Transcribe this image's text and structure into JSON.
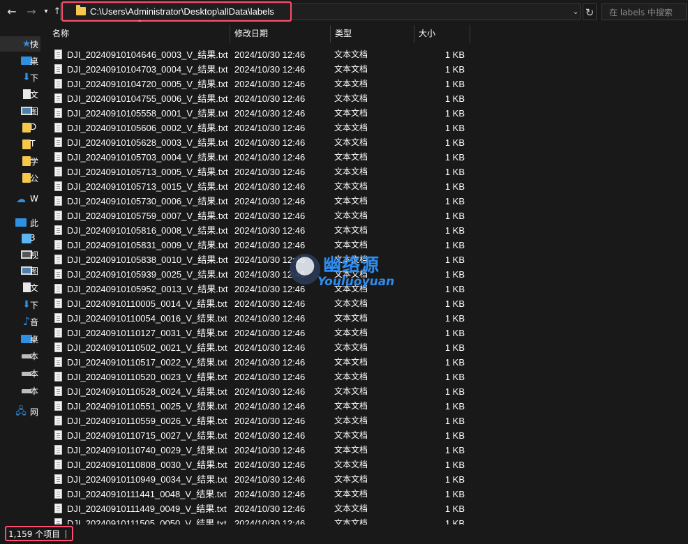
{
  "toolbar": {
    "back_icon": "arrow-left-icon",
    "forward_icon": "arrow-right-icon",
    "recent_icon": "chevron-down-icon",
    "up_icon": "arrow-up-icon",
    "address_path": "C:\\Users\\Administrator\\Desktop\\allData\\labels",
    "address_dropdown_icon": "chevron-down-icon",
    "refresh_icon": "refresh-icon",
    "search_placeholder": "在 labels 中搜索"
  },
  "sidebar": {
    "items": [
      {
        "icon": "star-icon",
        "label": "快",
        "selected": true
      },
      {
        "icon": "desktop-icon",
        "label": "桌"
      },
      {
        "icon": "download-icon",
        "label": "下"
      },
      {
        "icon": "document-icon",
        "label": "文"
      },
      {
        "icon": "picture-icon",
        "label": "图"
      },
      {
        "icon": "folder-icon",
        "label": "D"
      },
      {
        "icon": "folder-icon",
        "label": "T"
      },
      {
        "icon": "folder-icon",
        "label": "学"
      },
      {
        "icon": "folder-icon",
        "label": "公"
      },
      {
        "icon": "onedrive-icon",
        "label": "W"
      },
      {
        "icon": "computer-icon",
        "label": "此"
      },
      {
        "icon": "3d-objects-icon",
        "label": "3"
      },
      {
        "icon": "video-icon",
        "label": "视"
      },
      {
        "icon": "picture-icon",
        "label": "图"
      },
      {
        "icon": "document-icon",
        "label": "文"
      },
      {
        "icon": "download-icon",
        "label": "下"
      },
      {
        "icon": "music-icon",
        "label": "音"
      },
      {
        "icon": "desktop-icon",
        "label": "桌"
      },
      {
        "icon": "drive-icon",
        "label": "本"
      },
      {
        "icon": "drive-icon",
        "label": "本"
      },
      {
        "icon": "drive-icon",
        "label": "本"
      },
      {
        "icon": "network-icon",
        "label": "网"
      }
    ]
  },
  "columns": {
    "name": "名称",
    "date": "修改日期",
    "type": "类型",
    "size": "大小",
    "sort_icon": "sort-up-icon"
  },
  "files": [
    {
      "name": "DJI_20240910104646_0003_V_结果.txt",
      "date": "2024/10/30 12:46",
      "type": "文本文档",
      "size": "1 KB"
    },
    {
      "name": "DJI_20240910104703_0004_V_结果.txt",
      "date": "2024/10/30 12:46",
      "type": "文本文档",
      "size": "1 KB"
    },
    {
      "name": "DJI_20240910104720_0005_V_结果.txt",
      "date": "2024/10/30 12:46",
      "type": "文本文档",
      "size": "1 KB"
    },
    {
      "name": "DJI_20240910104755_0006_V_结果.txt",
      "date": "2024/10/30 12:46",
      "type": "文本文档",
      "size": "1 KB"
    },
    {
      "name": "DJI_20240910105558_0001_V_结果.txt",
      "date": "2024/10/30 12:46",
      "type": "文本文档",
      "size": "1 KB"
    },
    {
      "name": "DJI_20240910105606_0002_V_结果.txt",
      "date": "2024/10/30 12:46",
      "type": "文本文档",
      "size": "1 KB"
    },
    {
      "name": "DJI_20240910105628_0003_V_结果.txt",
      "date": "2024/10/30 12:46",
      "type": "文本文档",
      "size": "1 KB"
    },
    {
      "name": "DJI_20240910105703_0004_V_结果.txt",
      "date": "2024/10/30 12:46",
      "type": "文本文档",
      "size": "1 KB"
    },
    {
      "name": "DJI_20240910105713_0005_V_结果.txt",
      "date": "2024/10/30 12:46",
      "type": "文本文档",
      "size": "1 KB"
    },
    {
      "name": "DJI_20240910105713_0015_V_结果.txt",
      "date": "2024/10/30 12:46",
      "type": "文本文档",
      "size": "1 KB"
    },
    {
      "name": "DJI_20240910105730_0006_V_结果.txt",
      "date": "2024/10/30 12:46",
      "type": "文本文档",
      "size": "1 KB"
    },
    {
      "name": "DJI_20240910105759_0007_V_结果.txt",
      "date": "2024/10/30 12:46",
      "type": "文本文档",
      "size": "1 KB"
    },
    {
      "name": "DJI_20240910105816_0008_V_结果.txt",
      "date": "2024/10/30 12:46",
      "type": "文本文档",
      "size": "1 KB"
    },
    {
      "name": "DJI_20240910105831_0009_V_结果.txt",
      "date": "2024/10/30 12:46",
      "type": "文本文档",
      "size": "1 KB"
    },
    {
      "name": "DJI_20240910105838_0010_V_结果.txt",
      "date": "2024/10/30 12:46",
      "type": "文本文档",
      "size": "1 KB"
    },
    {
      "name": "DJI_20240910105939_0025_V_结果.txt",
      "date": "2024/10/30 12:46",
      "type": "文本文档",
      "size": "1 KB"
    },
    {
      "name": "DJI_20240910105952_0013_V_结果.txt",
      "date": "2024/10/30 12:46",
      "type": "文本文档",
      "size": "1 KB"
    },
    {
      "name": "DJI_20240910110005_0014_V_结果.txt",
      "date": "2024/10/30 12:46",
      "type": "文本文档",
      "size": "1 KB"
    },
    {
      "name": "DJI_20240910110054_0016_V_结果.txt",
      "date": "2024/10/30 12:46",
      "type": "文本文档",
      "size": "1 KB"
    },
    {
      "name": "DJI_20240910110127_0031_V_结果.txt",
      "date": "2024/10/30 12:46",
      "type": "文本文档",
      "size": "1 KB"
    },
    {
      "name": "DJI_20240910110502_0021_V_结果.txt",
      "date": "2024/10/30 12:46",
      "type": "文本文档",
      "size": "1 KB"
    },
    {
      "name": "DJI_20240910110517_0022_V_结果.txt",
      "date": "2024/10/30 12:46",
      "type": "文本文档",
      "size": "1 KB"
    },
    {
      "name": "DJI_20240910110520_0023_V_结果.txt",
      "date": "2024/10/30 12:46",
      "type": "文本文档",
      "size": "1 KB"
    },
    {
      "name": "DJI_20240910110528_0024_V_结果.txt",
      "date": "2024/10/30 12:46",
      "type": "文本文档",
      "size": "1 KB"
    },
    {
      "name": "DJI_20240910110551_0025_V_结果.txt",
      "date": "2024/10/30 12:46",
      "type": "文本文档",
      "size": "1 KB"
    },
    {
      "name": "DJI_20240910110559_0026_V_结果.txt",
      "date": "2024/10/30 12:46",
      "type": "文本文档",
      "size": "1 KB"
    },
    {
      "name": "DJI_20240910110715_0027_V_结果.txt",
      "date": "2024/10/30 12:46",
      "type": "文本文档",
      "size": "1 KB"
    },
    {
      "name": "DJI_20240910110740_0029_V_结果.txt",
      "date": "2024/10/30 12:46",
      "type": "文本文档",
      "size": "1 KB"
    },
    {
      "name": "DJI_20240910110808_0030_V_结果.txt",
      "date": "2024/10/30 12:46",
      "type": "文本文档",
      "size": "1 KB"
    },
    {
      "name": "DJI_20240910110949_0034_V_结果.txt",
      "date": "2024/10/30 12:46",
      "type": "文本文档",
      "size": "1 KB"
    },
    {
      "name": "DJI_20240910111441_0048_V_结果.txt",
      "date": "2024/10/30 12:46",
      "type": "文本文档",
      "size": "1 KB"
    },
    {
      "name": "DJI_20240910111449_0049_V_结果.txt",
      "date": "2024/10/30 12:46",
      "type": "文本文档",
      "size": "1 KB"
    },
    {
      "name": "DJI_20240910111505_0050_V_结果.txt",
      "date": "2024/10/30 12:46",
      "type": "文本文档",
      "size": "1 KB"
    }
  ],
  "watermark": {
    "text_cn": "幽络源",
    "text_en": "Youluoyuan"
  },
  "status": {
    "item_count": "1,159 个项目"
  },
  "colors": {
    "background": "#191919",
    "highlight": "#ff4d6d",
    "folder": "#f5c84c",
    "watermark": "#2d8cf0"
  }
}
